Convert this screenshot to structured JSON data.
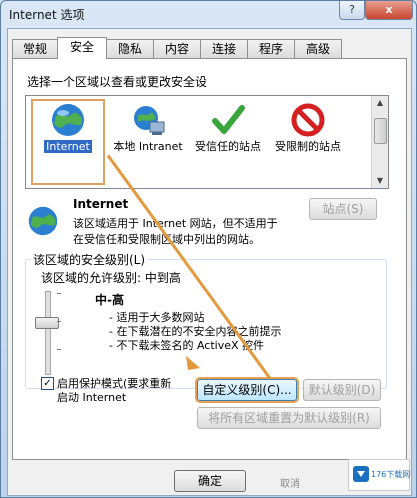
{
  "window": {
    "title": "Internet 选项",
    "help_label": "?",
    "close_label": "x"
  },
  "tabs": [
    {
      "label": "常规"
    },
    {
      "label": "安全",
      "active": true
    },
    {
      "label": "隐私"
    },
    {
      "label": "内容"
    },
    {
      "label": "连接"
    },
    {
      "label": "程序"
    },
    {
      "label": "高级"
    }
  ],
  "security": {
    "zone_prompt": "选择一个区域以查看或更改安全设",
    "zones": [
      {
        "label": "Internet",
        "icon": "globe-icon",
        "selected": true
      },
      {
        "label": "本地 Intranet",
        "icon": "local-intranet-icon"
      },
      {
        "label": "受信任的站点",
        "icon": "green-check-icon"
      },
      {
        "label": "受限制的站点",
        "icon": "red-prohibited-icon"
      }
    ],
    "zone_name": "Internet",
    "zone_desc_line1": "该区域适用于 Internet 网站，但不适用于",
    "zone_desc_line2": "在受信任和受限制区域中列出的网站。",
    "sites_button": "站点(S)",
    "level_group_label": "该区域的安全级别(L)",
    "allowed_levels": "该区域的允许级别: 中到高",
    "level_name": "中-高",
    "bullets": [
      "- 适用于大多数网站",
      "- 在下载潜在的不安全内容之前提示",
      "- 不下载未签名的 ActiveX 控件"
    ],
    "protected_mode_line1": "启用保护模式(要求重新",
    "protected_mode_line2": "启动 Internet",
    "protected_mode_checked": true,
    "custom_level_button": "自定义级别(C)...",
    "default_level_button": "默认级别(D)",
    "reset_all_button": "将所有区域重置为默认级别(R)"
  },
  "footer": {
    "ok_button": "确定",
    "cancel_button": "取消"
  },
  "watermark": {
    "text": "176下载网"
  },
  "colors": {
    "accent": "#3169c6",
    "annotation_arrow": "#e39a3d"
  }
}
